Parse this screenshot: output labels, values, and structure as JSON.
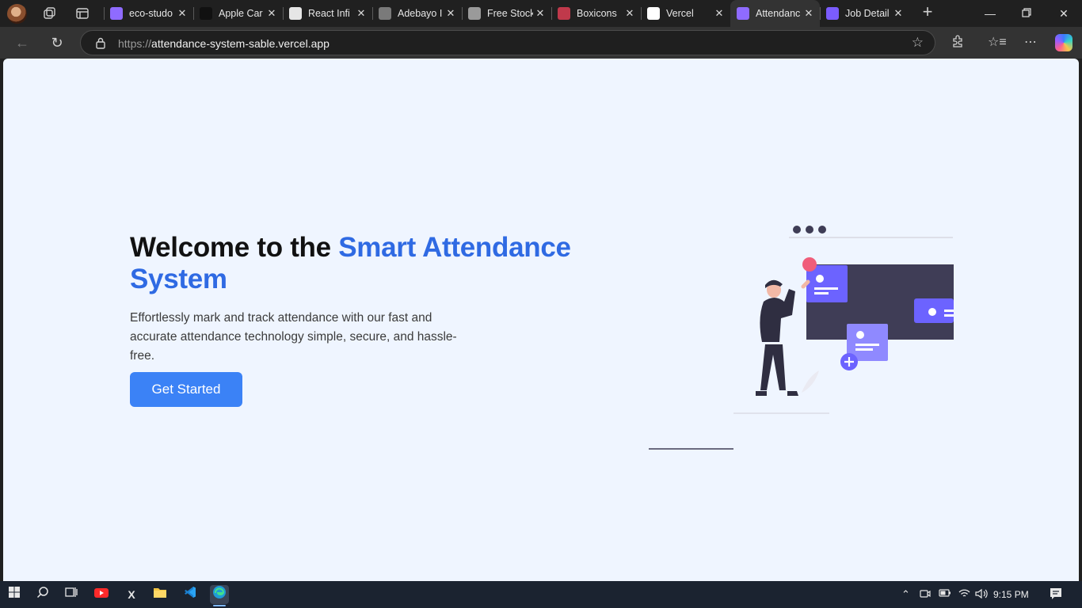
{
  "browser": {
    "tabs": [
      {
        "title": "eco-studo",
        "favicon": "vite-icon",
        "color": "#8f6bff"
      },
      {
        "title": "Apple Car",
        "favicon": "terminal-icon",
        "color": "#111111"
      },
      {
        "title": "React Infi",
        "favicon": "openai-icon",
        "color": "#e6e6e6"
      },
      {
        "title": "Adebayo I",
        "favicon": "linkedin-like-icon",
        "color": "#7a7a7a"
      },
      {
        "title": "Free Stock",
        "favicon": "pexels-icon",
        "color": "#9a9a9a"
      },
      {
        "title": "Boxicons",
        "favicon": "boxicons-icon",
        "color": "#c0394b"
      },
      {
        "title": "Vercel",
        "favicon": "vercel-icon",
        "color": "#ffffff"
      },
      {
        "title": "Attendanc",
        "favicon": "vite-icon",
        "color": "#8f6bff",
        "active": true
      },
      {
        "title": "Job Detail",
        "favicon": "star-of-david-icon",
        "color": "#7b5cff"
      }
    ],
    "address": {
      "scheme": "https://",
      "host": "attendance-system-sable.vercel.app"
    }
  },
  "hero": {
    "title_prefix": "Welcome to the ",
    "title_highlight": "Smart Attendance System",
    "description": "Effortlessly mark and track attendance with our fast and accurate attendance technology simple, secure, and hassle-free.",
    "cta_label": "Get Started"
  },
  "illustration": {
    "accent_color": "#6c63ff",
    "dark_color": "#3f3d56",
    "dot_color": "#f05d7a"
  },
  "taskbar": {
    "time": "9:15 PM"
  },
  "colors": {
    "highlight": "#2f6ae3",
    "button": "#3b82f6",
    "page_bg": "#eff5ff"
  }
}
